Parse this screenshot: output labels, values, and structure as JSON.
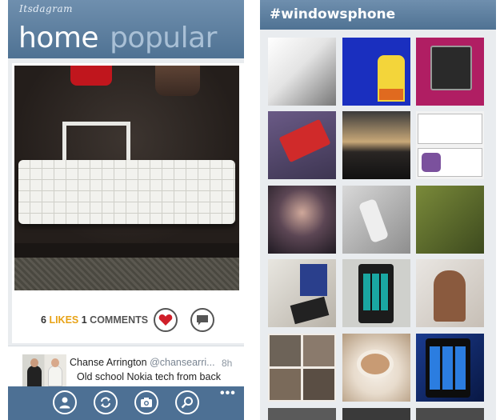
{
  "left_screen": {
    "app_title": "Itsdagram",
    "pivot": {
      "active": "home",
      "inactive": "popular"
    },
    "stats": {
      "likes_count": "6",
      "likes_label": "LIKES",
      "comments_count": "1",
      "comments_label": "COMMENTS"
    },
    "post": {
      "author_name": "Chanse Arrington",
      "author_handle": "@chansearri...",
      "time": "8h",
      "caption": "Old school Nokia tech from back"
    },
    "appbar": {
      "more": "•••"
    },
    "icons": [
      "heart-icon",
      "comment-icon",
      "profile-icon",
      "refresh-icon",
      "camera-icon",
      "search-icon"
    ]
  },
  "right_screen": {
    "title": "#windowsphone"
  },
  "colors": {
    "header": "#4f7293",
    "appbar": "#4d7094",
    "likes_accent": "#e8a317",
    "heart": "#d01f2a",
    "background": "#e9ecef"
  }
}
